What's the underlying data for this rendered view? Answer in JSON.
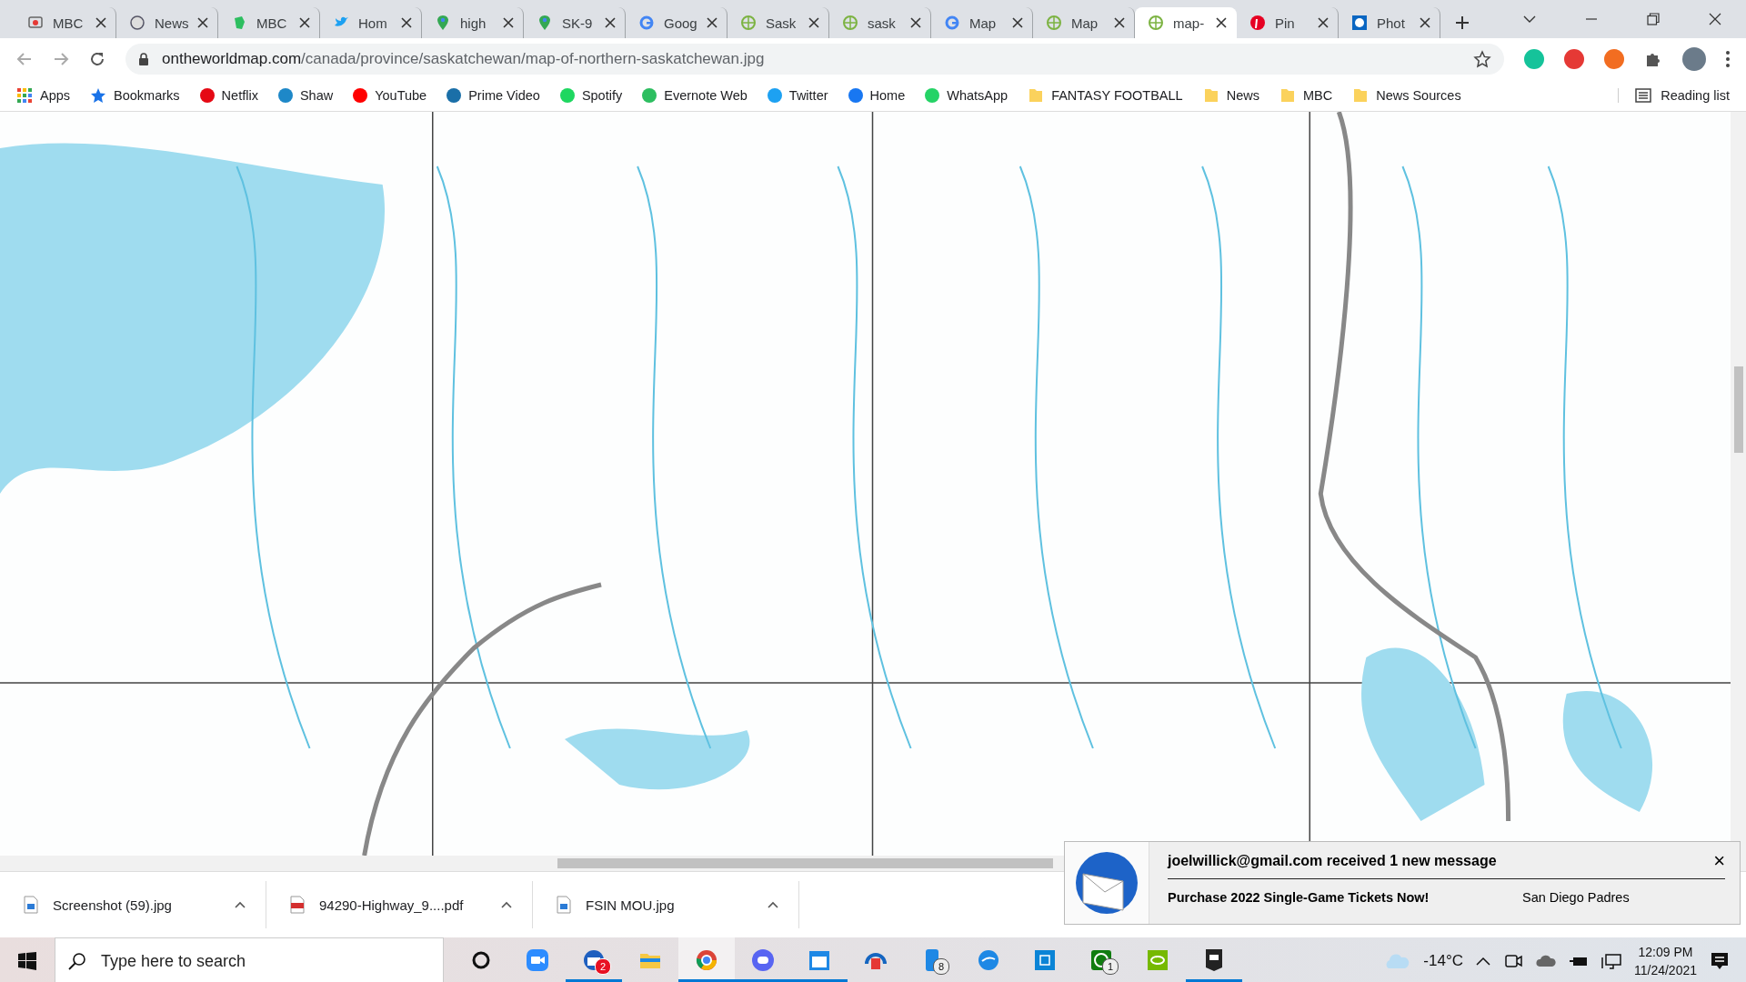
{
  "tabs": [
    {
      "title": "MBC",
      "kind": "chart",
      "selected": false
    },
    {
      "title": "News",
      "kind": "seal",
      "selected": false
    },
    {
      "title": "MBC",
      "kind": "evernote",
      "selected": false
    },
    {
      "title": "Hom",
      "kind": "twitter",
      "selected": false
    },
    {
      "title": "high",
      "kind": "maps",
      "selected": false
    },
    {
      "title": "SK-9",
      "kind": "maps",
      "selected": false
    },
    {
      "title": "Goog",
      "kind": "google",
      "selected": false
    },
    {
      "title": "Sask",
      "kind": "grid",
      "selected": false
    },
    {
      "title": "sask",
      "kind": "grid",
      "selected": false
    },
    {
      "title": "Map",
      "kind": "google",
      "selected": false
    },
    {
      "title": "Map",
      "kind": "grid",
      "selected": false
    },
    {
      "title": "map-",
      "kind": "grid",
      "selected": true
    },
    {
      "title": "Pin",
      "kind": "pinterest",
      "selected": false
    },
    {
      "title": "Phot",
      "kind": "photo",
      "selected": false
    }
  ],
  "address": {
    "domain": "ontheworldmap.com",
    "path": "/canada/province/saskatchewan/map-of-northern-saskatchewan.jpg"
  },
  "extensions": [
    {
      "color": "#15c39a"
    },
    {
      "color": "#e53935"
    },
    {
      "color": "#f26d21"
    }
  ],
  "bookmarks": [
    {
      "label": "Apps",
      "kind": "apps"
    },
    {
      "label": "Bookmarks",
      "kind": "star",
      "color": "#1a73e8"
    },
    {
      "label": "Netflix",
      "kind": "site",
      "color": "#e50914"
    },
    {
      "label": "Shaw",
      "kind": "site",
      "color": "#1e88c8"
    },
    {
      "label": "YouTube",
      "kind": "site",
      "color": "#ff0000"
    },
    {
      "label": "Prime Video",
      "kind": "site",
      "color": "#1a6fa8"
    },
    {
      "label": "Spotify",
      "kind": "site",
      "color": "#1ed760"
    },
    {
      "label": "Evernote Web",
      "kind": "site",
      "color": "#2dbe60"
    },
    {
      "label": "Twitter",
      "kind": "site",
      "color": "#1da1f2"
    },
    {
      "label": "Home",
      "kind": "site",
      "color": "#1877f2"
    },
    {
      "label": "WhatsApp",
      "kind": "site",
      "color": "#25d366"
    },
    {
      "label": "FANTASY FOOTBALL",
      "kind": "folder"
    },
    {
      "label": "News",
      "kind": "folder"
    },
    {
      "label": "MBC",
      "kind": "folder"
    },
    {
      "label": "News Sources",
      "kind": "folder"
    }
  ],
  "reading_list": "Reading list",
  "downloads": [
    {
      "name": "Screenshot (59).jpg",
      "kind": "image"
    },
    {
      "name": "94290-Highway_9....pdf",
      "kind": "pdf"
    },
    {
      "name": "FSIN MOU.jpg",
      "kind": "image"
    }
  ],
  "notification": {
    "title": "joelwillick@gmail.com received 1 new message",
    "subject": "Purchase 2022 Single-Game Tickets Now!",
    "sender": "San Diego Padres",
    "close": "×"
  },
  "taskbar": {
    "search_placeholder": "Type here to search",
    "apps": [
      {
        "kind": "cortana",
        "running": false,
        "selected": false
      },
      {
        "kind": "video",
        "running": false,
        "selected": false
      },
      {
        "kind": "mail",
        "badge": "2",
        "running": true,
        "selected": false
      },
      {
        "kind": "folder",
        "running": false,
        "selected": false
      },
      {
        "kind": "browser",
        "running": true,
        "selected": true
      },
      {
        "kind": "chat",
        "running": true,
        "selected": false
      },
      {
        "kind": "calendar",
        "running": true,
        "selected": false
      },
      {
        "kind": "audio",
        "running": false,
        "selected": false
      },
      {
        "kind": "phone",
        "badge": "8",
        "running": false,
        "selected": false
      },
      {
        "kind": "bird",
        "running": false,
        "selected": false
      },
      {
        "kind": "tiles",
        "running": false,
        "selected": false
      },
      {
        "kind": "xbox",
        "badge": "1",
        "running": false,
        "selected": false
      },
      {
        "kind": "gpu",
        "running": false,
        "selected": false
      },
      {
        "kind": "epic",
        "running": true,
        "selected": false
      }
    ],
    "temperature": "-14°C",
    "time": "12:09 PM",
    "date": "11/24/2021"
  }
}
